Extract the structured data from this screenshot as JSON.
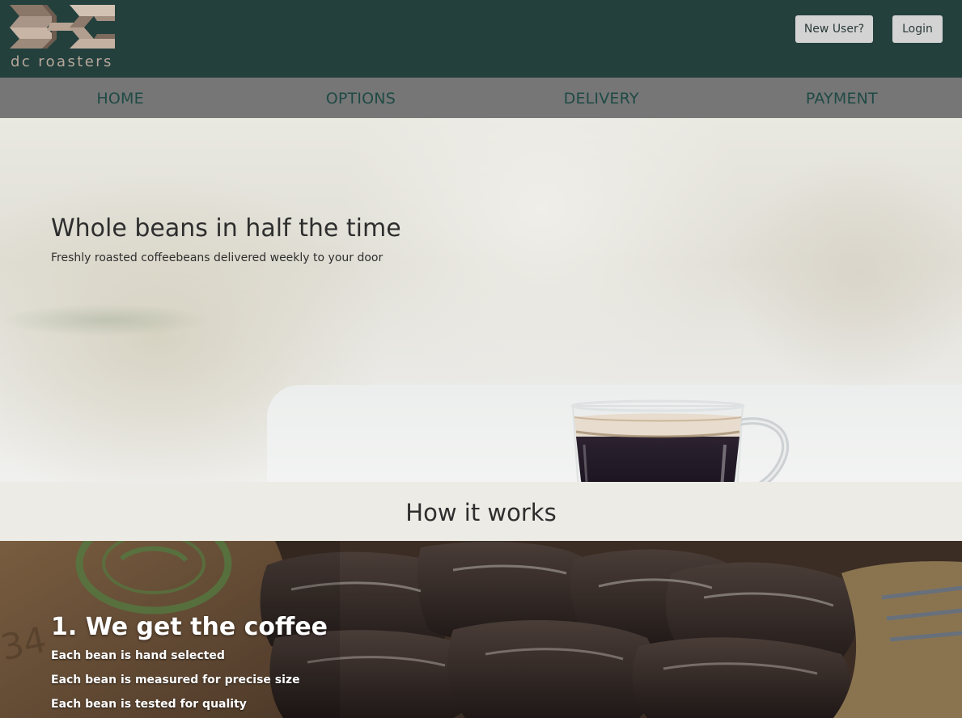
{
  "brand": {
    "name": "dc roasters",
    "logo_icon": "dc-logo-icon"
  },
  "header": {
    "new_user_label": "New User?",
    "login_label": "Login",
    "background_color": "#23403d",
    "button_color": "#d3d3d3"
  },
  "nav": {
    "background_color": "#767676",
    "text_color": "#1f4a45",
    "items": [
      {
        "label": "HOME"
      },
      {
        "label": "OPTIONS"
      },
      {
        "label": "DELIVERY"
      },
      {
        "label": "PAYMENT"
      }
    ]
  },
  "hero": {
    "title": "Whole beans in half the time",
    "subtitle": "Freshly roasted coffeebeans delivered weekly to your door",
    "image_icon": "coffee-cup-icon"
  },
  "how": {
    "title": "How it works"
  },
  "steps": [
    {
      "title": "1. We get the coffee",
      "lines": [
        "Each bean is hand selected",
        "Each bean is measured for precise size",
        "Each bean is tested for quality"
      ],
      "image_icon": "coffee-sacks-icon"
    }
  ]
}
